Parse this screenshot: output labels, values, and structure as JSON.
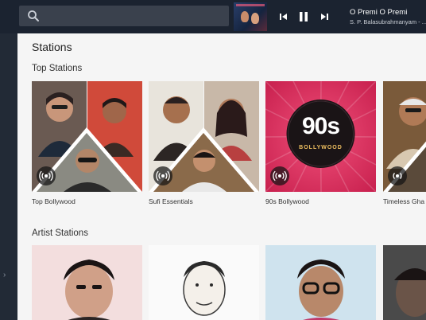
{
  "header": {
    "search_icon": "search-icon",
    "now_playing": {
      "title": "O Premi O Premi",
      "artist": "S. P. Balasubrahmanyam - ..."
    },
    "controls": [
      "previous-icon",
      "pause-icon",
      "next-icon"
    ]
  },
  "page": {
    "title": "Stations"
  },
  "top_stations": {
    "heading": "Top Stations",
    "items": [
      {
        "label": "Top Bollywood"
      },
      {
        "label": "Sufi Essentials"
      },
      {
        "label": "90s Bollywood",
        "art_text": "90s",
        "art_sub": "BOLLYWOOD"
      },
      {
        "label": "Timeless Gha"
      }
    ]
  },
  "artist_stations": {
    "heading": "Artist Stations"
  },
  "colors": {
    "topbar": "#1b2330",
    "accent_pink": "#e0305e",
    "background": "#f5f5f5"
  }
}
